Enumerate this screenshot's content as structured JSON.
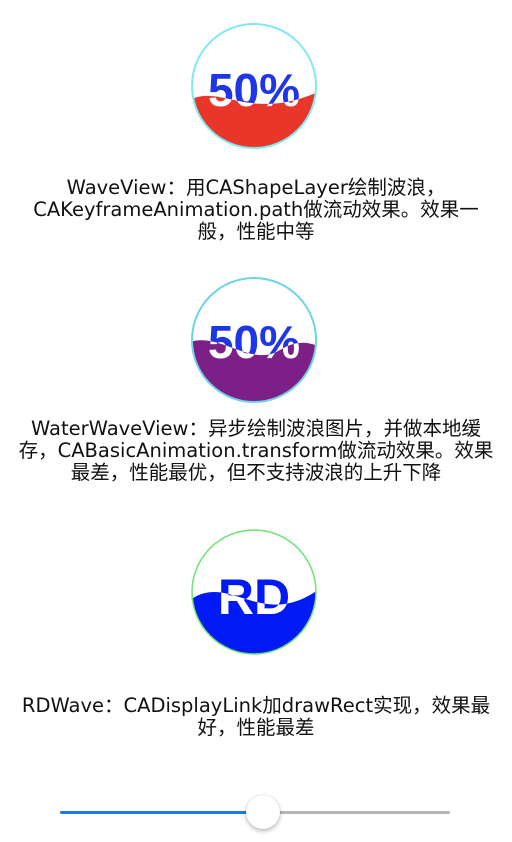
{
  "colors": {
    "wave1_fill": "#e8362a",
    "wave1_ring": "#7fe9f2",
    "wave1_text": "#1f36e6",
    "wave2_fill": "#7c1f86",
    "wave2_ring": "#6dd4e3",
    "wave2_text": "#1f36e6",
    "wave3_fill": "#0019f5",
    "wave3_ring": "#6fe46f",
    "wave3_text": "#0019f5",
    "slider_min_track": "#1d7bf0",
    "slider_max_track": "#b6b6ba"
  },
  "waves": [
    {
      "text": "50%",
      "description": "WaveView：用CAShapeLayer绘制波浪，CAKeyframeAnimation.path做流动效果。效果一般，性能中等"
    },
    {
      "text": "50%",
      "description": "WaterWaveView：异步绘制波浪图片，并做本地缓存，CABasicAnimation.transform做流动效果。效果最差，性能最优，但不支持波浪的上升下降"
    },
    {
      "text": "RD",
      "description": "RDWave：CADisplayLink加drawRect实现，效果最好，性能最差"
    }
  ],
  "slider": {
    "value": 0.52
  }
}
